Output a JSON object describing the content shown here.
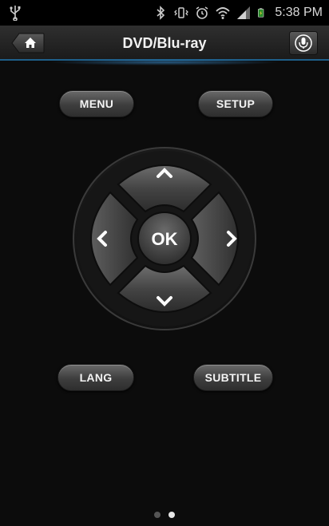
{
  "status_bar": {
    "time": "5:38 PM",
    "icons": [
      "usb-icon",
      "bluetooth-icon",
      "vibrate-icon",
      "alarm-icon",
      "wifi-icon",
      "signal-icon",
      "battery-icon"
    ]
  },
  "title_bar": {
    "title": "DVD/Blu-ray",
    "home_icon": "home-icon",
    "mic_icon": "microphone-icon"
  },
  "buttons": {
    "menu": "MENU",
    "setup": "SETUP",
    "lang": "LANG",
    "subtitle": "SUBTITLE"
  },
  "dpad": {
    "ok": "OK",
    "up_icon": "chevron-up-icon",
    "down_icon": "chevron-down-icon",
    "left_icon": "chevron-left-icon",
    "right_icon": "chevron-right-icon"
  },
  "pager": {
    "page_count": 2,
    "current_page": 2
  },
  "colors": {
    "accent": "#1e5f8a",
    "background": "#0c0c0c"
  }
}
